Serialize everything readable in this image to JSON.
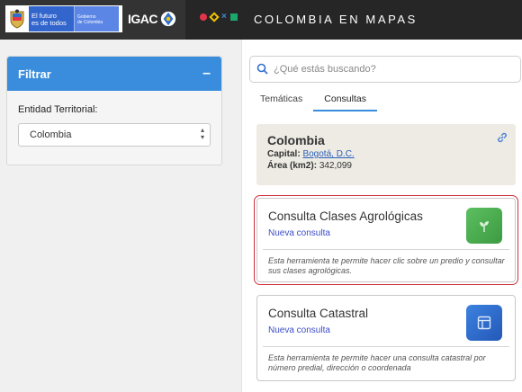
{
  "header": {
    "gov_text_line1": "El futuro",
    "gov_text_line2": "es de todos",
    "gov_sub_line1": "Gobierno",
    "gov_sub_line2": "de Colombia",
    "igac_text": "IGAC",
    "brand_title": "COLOMBIA EN MAPAS"
  },
  "filter": {
    "title": "Filtrar",
    "collapse_symbol": "–",
    "label": "Entidad Territorial:",
    "selected": "Colombia"
  },
  "search": {
    "placeholder": "¿Qué estás buscando?"
  },
  "tabs": [
    {
      "label": "Temáticas",
      "active": false
    },
    {
      "label": "Consultas",
      "active": true
    }
  ],
  "info": {
    "title": "Colombia",
    "capital_label": "Capital:",
    "capital_value": "Bogotá, D.C.",
    "area_label": "Área (km2):",
    "area_value": "342,099"
  },
  "tools": [
    {
      "title": "Consulta Clases Agrológicas",
      "subtitle": "Nueva consulta",
      "description": "Esta herramienta te permite hacer clic sobre un predio y consultar sus clases agrológicas.",
      "icon": "plant-icon",
      "color": "#4caf50"
    },
    {
      "title": "Consulta Catastral",
      "subtitle": "Nueva consulta",
      "description": "Esta herramienta te permite hacer una consulta catastral por número predial, dirección o coordenada",
      "icon": "layout-icon",
      "color": "#2f6ed1"
    }
  ],
  "colors": {
    "accent": "#3a8ddd",
    "header_bg": "#333333",
    "selection_outline": "#d0303d"
  }
}
